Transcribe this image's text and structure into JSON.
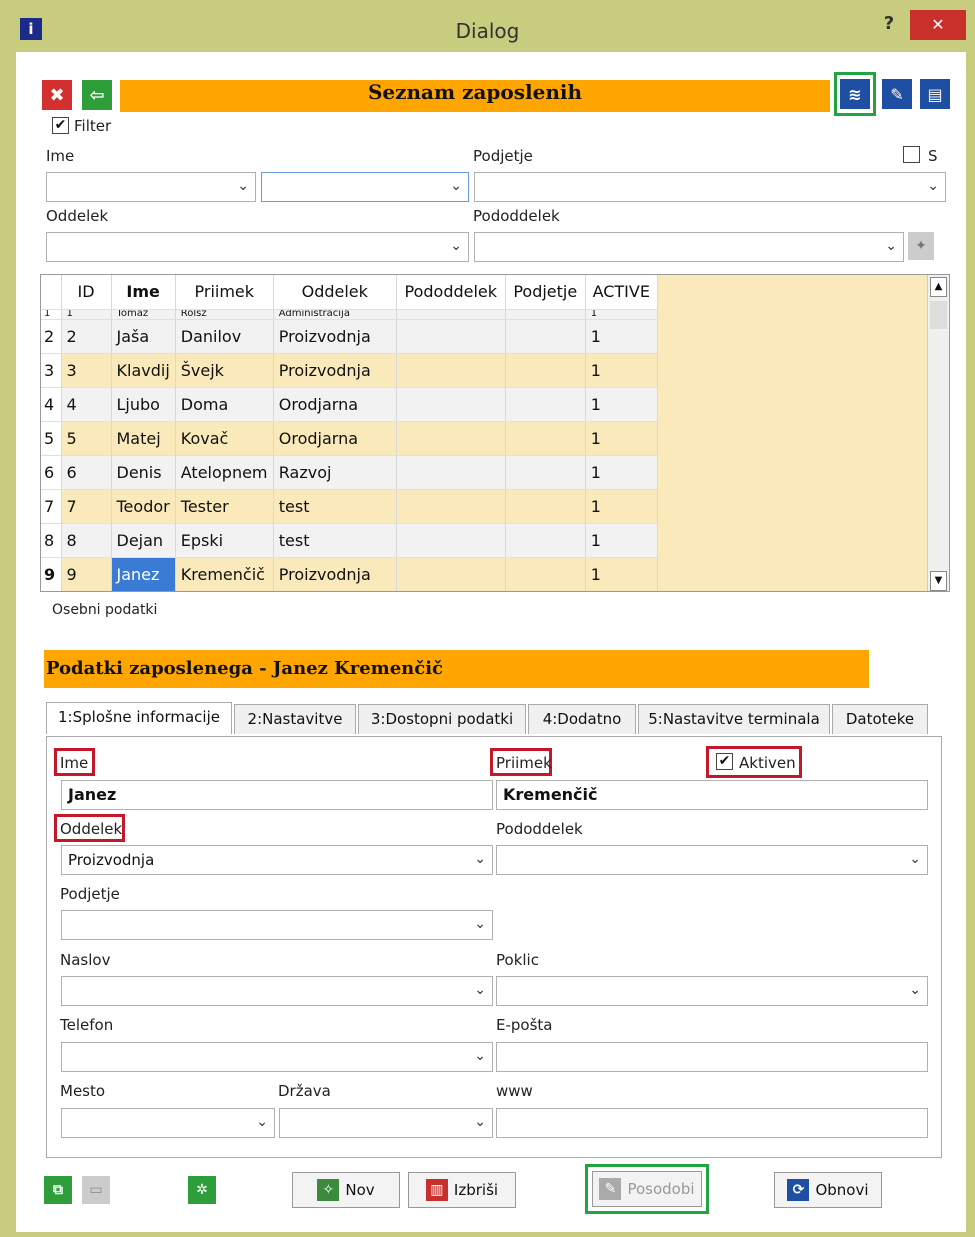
{
  "window": {
    "title": "Dialog",
    "help": "?",
    "close": "✕",
    "app_icon": "i"
  },
  "header": {
    "title": "Seznam zaposlenih"
  },
  "icons": {
    "delete": "delete-icon",
    "back": "arrow-left-icon",
    "database": "database-icon",
    "edit": "edit-icon",
    "form": "form-icon"
  },
  "filter": {
    "label": "Filter",
    "checked": true,
    "ime_label": "Ime",
    "podjetje_label": "Podjetje",
    "s_label": "S",
    "oddelek_label": "Oddelek",
    "pododdelek_label": "Pododdelek"
  },
  "grid": {
    "columns": [
      "ID",
      "Ime",
      "Priimek",
      "Oddelek",
      "Pododdelek",
      "Podjetje",
      "ACTIVE"
    ],
    "partial_row": {
      "row": "1",
      "id": "1",
      "ime": "Tomaž",
      "priimek": "Rolsz",
      "oddelek": "Administracija",
      "active": "1"
    },
    "rows": [
      {
        "row": "2",
        "id": "2",
        "ime": "Jaša",
        "priimek": "Danilov",
        "oddelek": "Proizvodnja",
        "pododdelek": "",
        "podjetje": "",
        "active": "1"
      },
      {
        "row": "3",
        "id": "3",
        "ime": "Klavdij",
        "priimek": "Švejk",
        "oddelek": "Proizvodnja",
        "pododdelek": "",
        "podjetje": "",
        "active": "1"
      },
      {
        "row": "4",
        "id": "4",
        "ime": "Ljubo",
        "priimek": "Doma",
        "oddelek": "Orodjarna",
        "pododdelek": "",
        "podjetje": "",
        "active": "1"
      },
      {
        "row": "5",
        "id": "5",
        "ime": "Matej",
        "priimek": "Kovač",
        "oddelek": "Orodjarna",
        "pododdelek": "",
        "podjetje": "",
        "active": "1"
      },
      {
        "row": "6",
        "id": "6",
        "ime": "Denis",
        "priimek": "Atelopnem",
        "oddelek": "Razvoj",
        "pododdelek": "",
        "podjetje": "",
        "active": "1"
      },
      {
        "row": "7",
        "id": "7",
        "ime": "Teodor",
        "priimek": "Tester",
        "oddelek": "test",
        "pododdelek": "",
        "podjetje": "",
        "active": "1"
      },
      {
        "row": "8",
        "id": "8",
        "ime": "Dejan",
        "priimek": "Epski",
        "oddelek": "test",
        "pododdelek": "",
        "podjetje": "",
        "active": "1"
      },
      {
        "row": "9",
        "id": "9",
        "ime": "Janez",
        "priimek": "Kremenčič",
        "oddelek": "Proizvodnja",
        "pododdelek": "",
        "podjetje": "",
        "active": "1"
      }
    ]
  },
  "personal": {
    "group_label": "Osebni podatki",
    "banner": "Podatki zaposlenega - Janez Kremenčič",
    "tabs": [
      "1:Splošne informacije",
      "2:Nastavitve",
      "3:Dostopni podatki",
      "4:Dodatno",
      "5:Nastavitve terminala",
      "Datoteke"
    ],
    "ime_label": "Ime",
    "ime_value": "Janez",
    "priimek_label": "Priimek",
    "priimek_value": "Kremenčič",
    "aktiven_label": "Aktiven",
    "aktiven_checked": true,
    "oddelek_label": "Oddelek",
    "oddelek_value": "Proizvodnja",
    "pododdelek_label": "Pododdelek",
    "pododdelek_value": "",
    "podjetje_label": "Podjetje",
    "podjetje_value": "",
    "naslov_label": "Naslov",
    "naslov_value": "",
    "poklic_label": "Poklic",
    "poklic_value": "",
    "telefon_label": "Telefon",
    "telefon_value": "",
    "eposta_label": "E-pošta",
    "eposta_value": "",
    "mesto_label": "Mesto",
    "mesto_value": "",
    "drzava_label": "Država",
    "drzava_value": "",
    "www_label": "www",
    "www_value": ""
  },
  "footer": {
    "nov": "Nov",
    "izbrisi": "Izbriši",
    "posodobi": "Posodobi",
    "obnovi": "Obnovi"
  },
  "colors": {
    "accent_orange": "#ffa500",
    "highlight_green": "#22a540",
    "highlight_red": "#c4182a",
    "selection_blue": "#3a7bd5"
  }
}
